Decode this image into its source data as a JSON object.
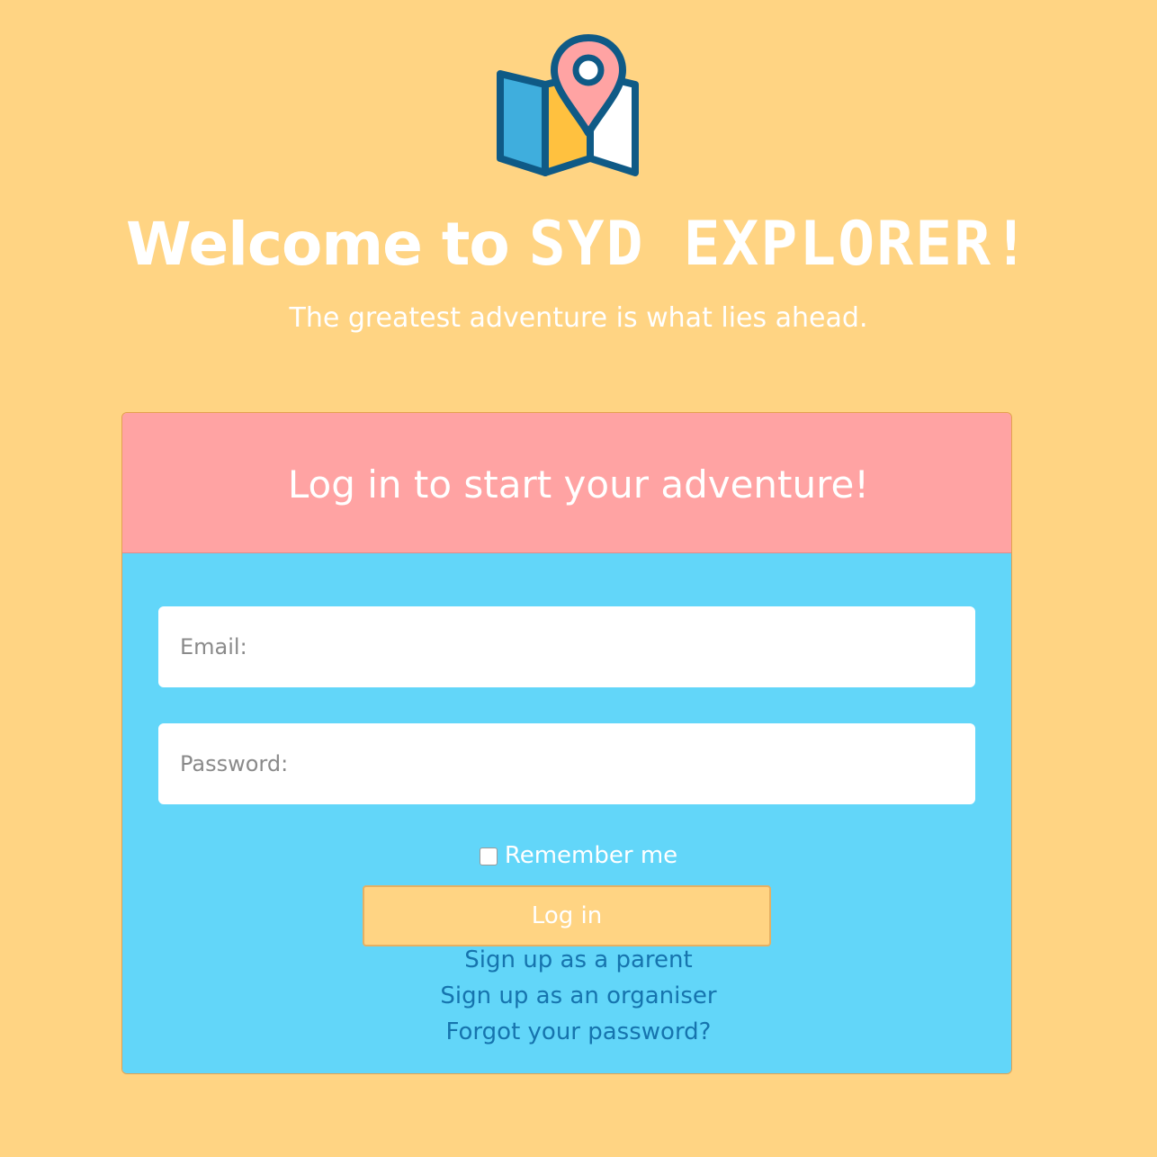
{
  "header": {
    "title_prefix": "Welcome to",
    "brand_name": "SYD EXPLORER!",
    "subtitle": "The greatest adventure is what lies ahead.",
    "logo_icon": "map-pin-icon"
  },
  "login_card": {
    "title": "Log in to start your adventure!",
    "email_placeholder": "Email:",
    "password_placeholder": "Password:",
    "remember_label": "Remember me",
    "login_button_label": "Log in",
    "links": {
      "signup_parent": "Sign up as a parent",
      "signup_organiser": "Sign up as an organiser",
      "forgot_password": "Forgot your password?"
    }
  },
  "colors": {
    "background": "#FFD483",
    "card_header": "#FFA3A3",
    "card_body": "#62D6F9",
    "link": "#1674AE",
    "button": "#FFD483"
  }
}
